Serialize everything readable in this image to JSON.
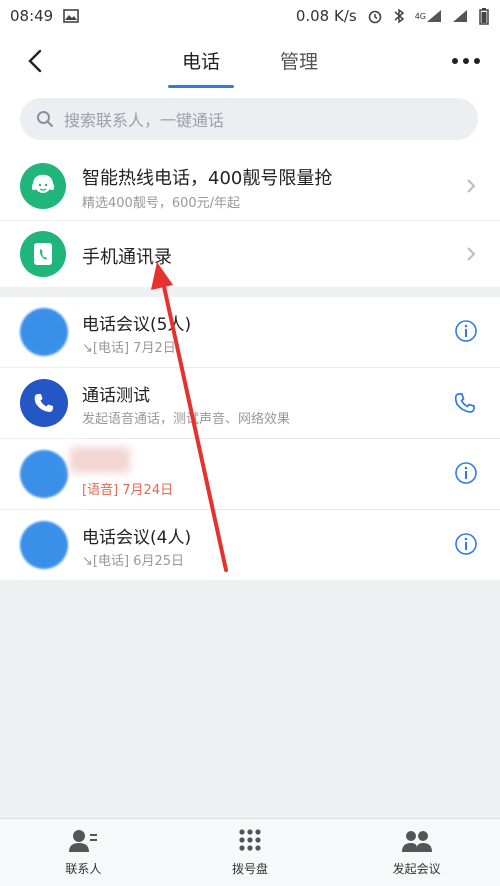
{
  "status_bar": {
    "time": "08:49",
    "speed": "0.08 K/s",
    "network_label": "4G"
  },
  "header": {
    "tabs": [
      {
        "label": "电话",
        "active": true
      },
      {
        "label": "管理",
        "active": false
      }
    ]
  },
  "search": {
    "placeholder": "搜索联系人，一键通话"
  },
  "menu": {
    "hotline": {
      "title": "智能热线电话，400靓号限量抢",
      "subtitle": "精选400靓号，600元/年起"
    },
    "contacts": {
      "title": "手机通讯录"
    }
  },
  "calls": [
    {
      "title": "电话会议(5人)",
      "subtitle": "↘[电话] 7月2日",
      "action": "info-icon"
    },
    {
      "title": "通话测试",
      "subtitle": "发起语音通话，测试声音、网络效果",
      "action": "phone-icon"
    },
    {
      "title": "",
      "subtitle": "[语音] 7月24日",
      "action": "info-icon"
    },
    {
      "title": "电话会议(4人)",
      "subtitle": "↘[电话] 6月25日",
      "action": "info-icon"
    }
  ],
  "bottom_nav": [
    {
      "label": "联系人",
      "icon": "contacts-icon"
    },
    {
      "label": "拨号盘",
      "icon": "dialpad-icon"
    },
    {
      "label": "发起会议",
      "icon": "meeting-icon"
    }
  ],
  "colors": {
    "accent": "#2f7de1",
    "green": "#20b57a",
    "annotation_arrow": "#e5322d"
  }
}
